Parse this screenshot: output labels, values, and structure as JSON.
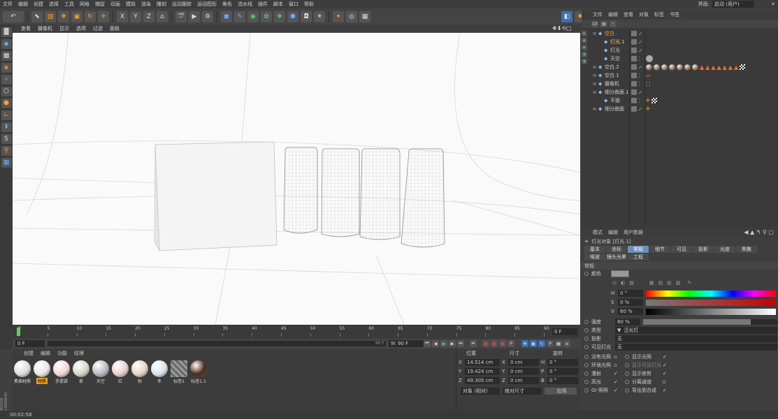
{
  "menu": [
    "文件",
    "编辑",
    "创建",
    "选择",
    "工具",
    "网格",
    "捕捉",
    "动画",
    "模拟",
    "渲染",
    "雕刻",
    "运动跟踪",
    "运动图形",
    "角色",
    "流水线",
    "插件",
    "脚本",
    "窗口",
    "帮助"
  ],
  "interface_label": "界面:",
  "interface_value": "启动 (用户)",
  "toolbar": {
    "undo": "↶",
    "axis_x": "X",
    "axis_y": "Y",
    "axis_z": "Z"
  },
  "viewport_menu": [
    "查看",
    "摄像机",
    "显示",
    "选项",
    "过滤",
    "面板"
  ],
  "timeline": {
    "ticks": [
      "0",
      "5",
      "10",
      "15",
      "20",
      "25",
      "30",
      "35",
      "40",
      "45",
      "50",
      "55",
      "60",
      "65",
      "70",
      "75",
      "80",
      "85",
      "90"
    ],
    "current_frame": "0 F",
    "start": "0 F",
    "end": "90 F",
    "end2": "90 F",
    "range_end": "90 F"
  },
  "materials": {
    "menu": [
      "创建",
      "编辑",
      "功能",
      "纹理"
    ],
    "items": [
      {
        "label": "素描材质",
        "color": "#dcdcdc"
      },
      {
        "label": "材质",
        "color": "#e6e6e6",
        "selected": true
      },
      {
        "label": "手提袋",
        "color": "#f0d8d0"
      },
      {
        "label": "茶",
        "color": "#cfd8c8"
      },
      {
        "label": "天空",
        "color": "#b8b8c0"
      },
      {
        "label": "红",
        "color": "#e8cfcf"
      },
      {
        "label": "秋",
        "color": "#e5d2c2"
      },
      {
        "label": "冬",
        "color": "#d8e3ea"
      },
      {
        "label": "标签1",
        "color": "#888"
      },
      {
        "label": "标签1.1",
        "color": "#4a2a18"
      }
    ]
  },
  "coords": {
    "headers": [
      "位置",
      "尺寸",
      "旋转"
    ],
    "rows": [
      {
        "axis": "X",
        "pos": "14.514 cm",
        "size": "0 cm",
        "rlabel": "H",
        "rot": "0 °"
      },
      {
        "axis": "Y",
        "pos": "19.424 cm",
        "size": "0 cm",
        "rlabel": "P",
        "rot": "0 °"
      },
      {
        "axis": "Z",
        "pos": "49.305 cm",
        "size": "0 cm",
        "rlabel": "B",
        "rot": "0 °"
      }
    ],
    "mode1": "对象 (相对)",
    "mode2": "绝对尺寸",
    "apply": "应用"
  },
  "status": "00:02:58",
  "objmgr": {
    "menu": [
      "文件",
      "编辑",
      "查看",
      "对象",
      "标签",
      "书签"
    ],
    "rows": [
      {
        "indent": 0,
        "label": "空白",
        "color": "#ff9b2e"
      },
      {
        "indent": 1,
        "label": "灯光.1",
        "color": "#ffc070"
      },
      {
        "indent": 1,
        "label": "灯光",
        "color": "#d0d0d0"
      },
      {
        "indent": 1,
        "label": "天空",
        "color": "#d0d0d0"
      },
      {
        "indent": 0,
        "label": "空白.2",
        "color": "#d0d0d0"
      },
      {
        "indent": 0,
        "label": "空白.1",
        "color": "#d0d0d0"
      },
      {
        "indent": 0,
        "label": "摄像机",
        "color": "#d0d0d0"
      },
      {
        "indent": 0,
        "label": "细分曲面.1",
        "color": "#d0d0d0"
      },
      {
        "indent": 1,
        "label": "平面",
        "color": "#d0d0d0"
      },
      {
        "indent": 0,
        "label": "细分曲面",
        "color": "#d0d0d0"
      }
    ]
  },
  "attr": {
    "menu": [
      "模式",
      "编辑",
      "用户数据"
    ],
    "object_title": "灯光对象 [灯光.1]",
    "tabs": [
      "基本",
      "坐标",
      "常规",
      "细节",
      "可见",
      "投影",
      "光度",
      "焦散",
      "噪波",
      "镜头光晕",
      "工程"
    ],
    "section": "常规",
    "color_label": "颜色",
    "h_label": "H",
    "h_val": "0 °",
    "s_label": "S",
    "s_val": "0 %",
    "v_label": "V",
    "v_val": "60 %",
    "intensity_label": "强度",
    "intensity_val": "80 %",
    "intensity_level": 0.8,
    "type_label": "类型",
    "type_val": "泛光灯",
    "shadow_label": "投影",
    "shadow_val": "无",
    "vislight_label": "可见灯光",
    "vislight_val": "无",
    "checks_left": [
      "没有光照",
      "环境光照",
      "漫射",
      "高光",
      "GI 照明"
    ],
    "checks_right": [
      "显示光照",
      "显示可见灯光",
      "显示修剪",
      "分离通道",
      "导出到合成"
    ]
  }
}
